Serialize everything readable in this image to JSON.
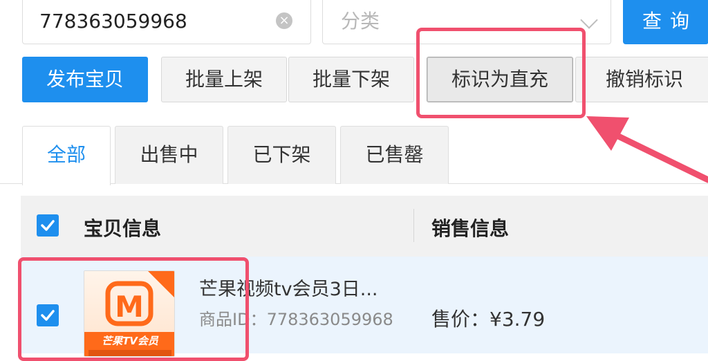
{
  "search": {
    "value": "778363059968",
    "clear_icon": "×"
  },
  "category": {
    "placeholder": "分类"
  },
  "query_label": "查询",
  "actions": {
    "publish": "发布宝贝",
    "batch_on": "批量上架",
    "batch_off": "批量下架",
    "mark_direct": "标识为直充",
    "cancel_mark": "撤销标识"
  },
  "tabs": [
    {
      "label": "全部",
      "active": true
    },
    {
      "label": "出售中"
    },
    {
      "label": "已下架"
    },
    {
      "label": "已售罄"
    }
  ],
  "table": {
    "columns": [
      "宝贝信息",
      "销售信息"
    ],
    "rows": [
      {
        "checked": true,
        "name": "芒果视频tv会员3日...",
        "id_label": "商品ID：",
        "id_value": "778363059968",
        "price_label": "售价：",
        "price_value": "¥3.79",
        "thumb": {
          "logo_letter": "M",
          "caption": "芒果TV会员",
          "corner_tag": ""
        }
      }
    ]
  },
  "colors": {
    "accent": "#1e8fee",
    "highlight": "#f0506e",
    "brand_orange": "#ff6a1a"
  }
}
